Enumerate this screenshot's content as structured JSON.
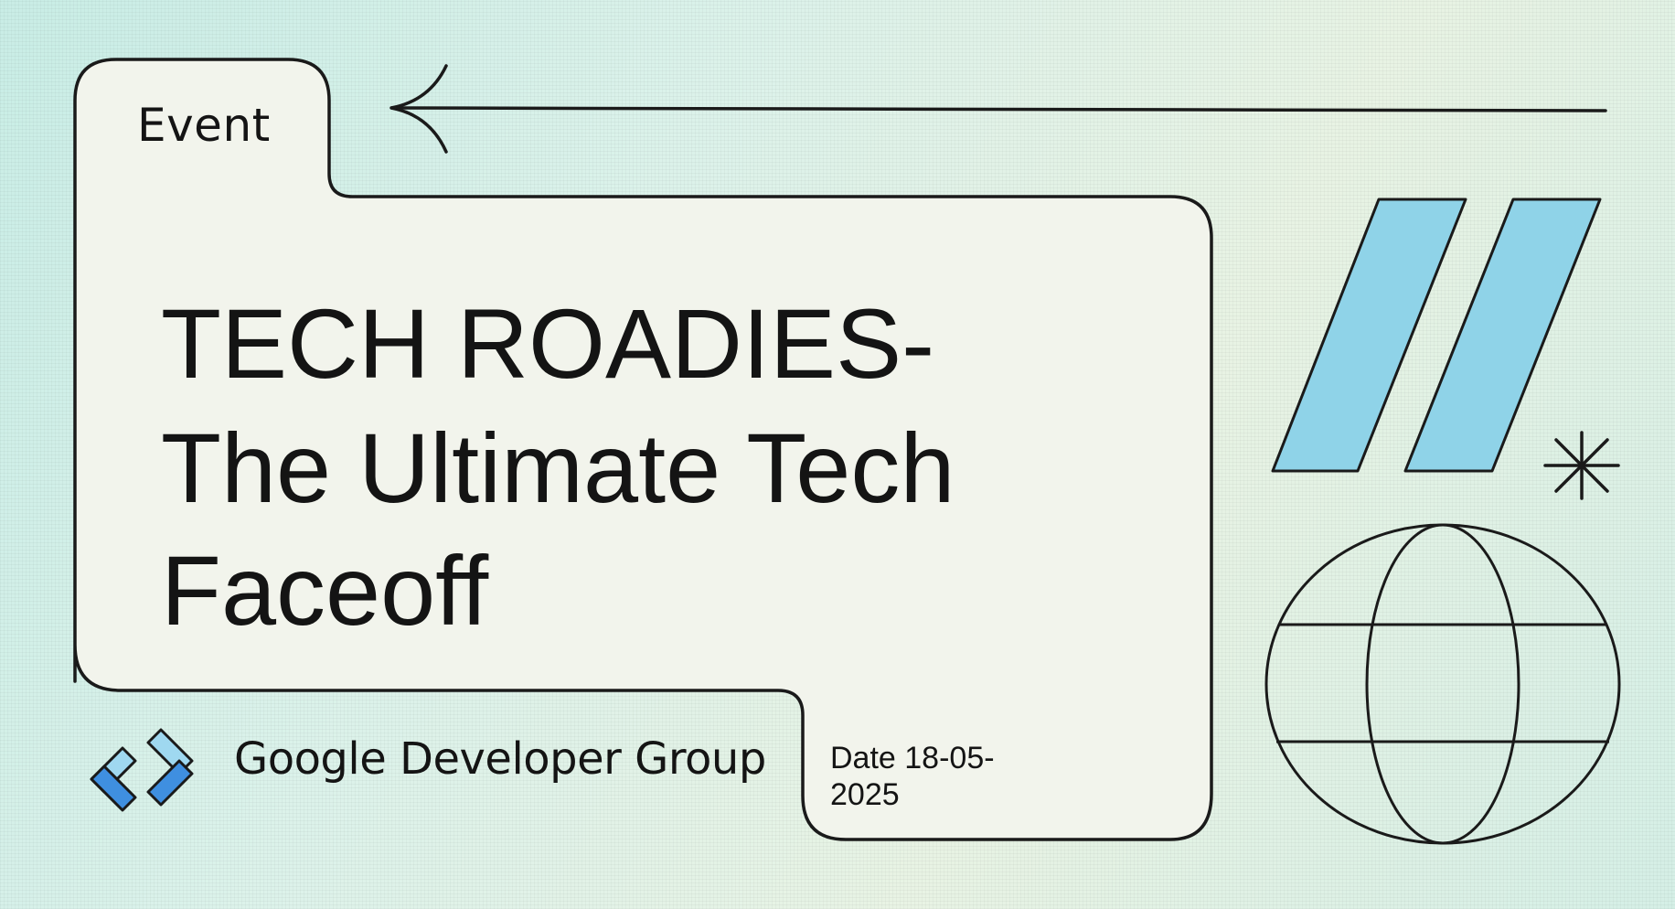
{
  "slide": {
    "tag": "Event",
    "title_lines": [
      "TECH ROADIES-",
      "The Ultimate Tech",
      "Faceoff"
    ],
    "brand": {
      "name": "Google Developer Group",
      "logo_icon": "gdg-chevrons-logo-icon"
    },
    "date_lines": [
      "Date 18-05-",
      "2025"
    ],
    "decorations": [
      "back-arrow-icon",
      "slash-stripes-icon",
      "asterisk-icon",
      "globe-icon"
    ],
    "colors": {
      "background": "#d8f1ea",
      "card": "#f2f4ec",
      "outline": "#1a1a1a",
      "stripe_fill": "#8fd3e8",
      "logo_light": "#9fd8f0",
      "logo_dark": "#3f8fe0"
    }
  }
}
